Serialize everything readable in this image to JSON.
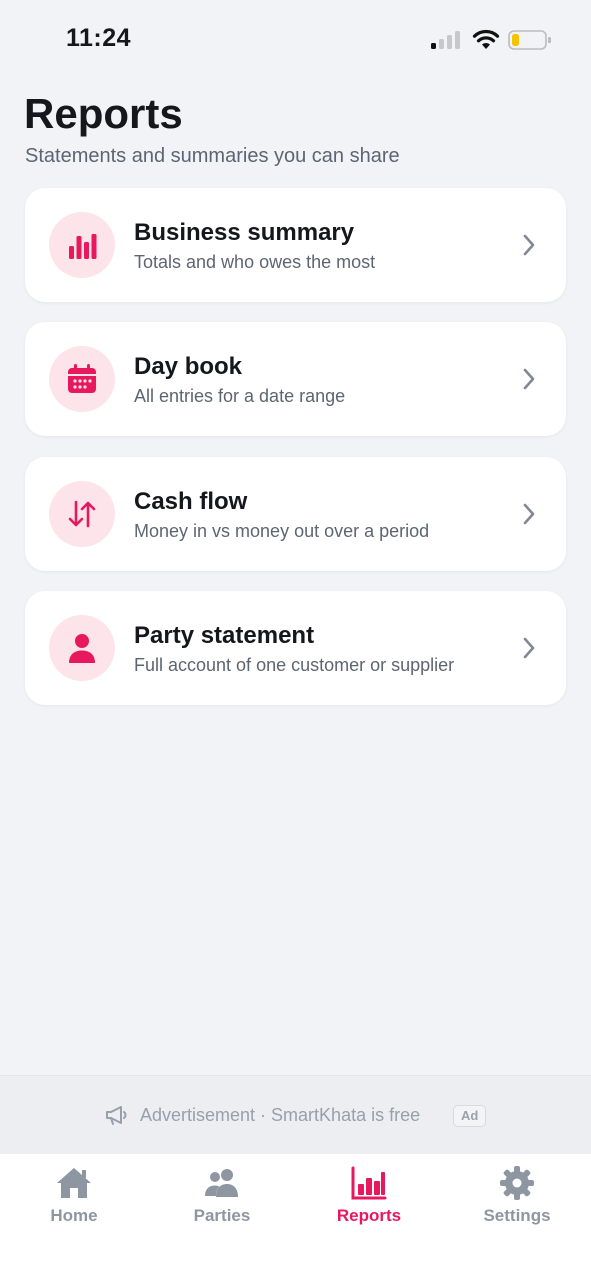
{
  "status_bar": {
    "time": "11:24"
  },
  "header": {
    "title": "Reports",
    "subtitle": "Statements and summaries you can share"
  },
  "reports": [
    {
      "title": "Business summary",
      "description": "Totals and who owes the most",
      "icon": "bar-chart-icon"
    },
    {
      "title": "Day book",
      "description": "All entries for a date range",
      "icon": "calendar-icon"
    },
    {
      "title": "Cash flow",
      "description": "Money in vs money out over a period",
      "icon": "swap-arrows-icon"
    },
    {
      "title": "Party statement",
      "description": "Full account of one customer or supplier",
      "icon": "person-icon"
    }
  ],
  "ad_banner": {
    "text": "Advertisement · SmartKhata is free",
    "badge": "Ad",
    "icon": "megaphone-icon"
  },
  "tab_bar": {
    "tabs": [
      {
        "label": "Home",
        "icon": "home-icon",
        "active": false
      },
      {
        "label": "Parties",
        "icon": "people-icon",
        "active": false
      },
      {
        "label": "Reports",
        "icon": "bar-chart-icon",
        "active": true
      },
      {
        "label": "Settings",
        "icon": "gear-icon",
        "active": false
      }
    ]
  },
  "colors": {
    "accent": "#e8185f",
    "icon_bg": "#fde3ea",
    "background": "#f2f3f7",
    "muted_text": "#5d6572",
    "inactive_tab": "#8e96a2"
  }
}
